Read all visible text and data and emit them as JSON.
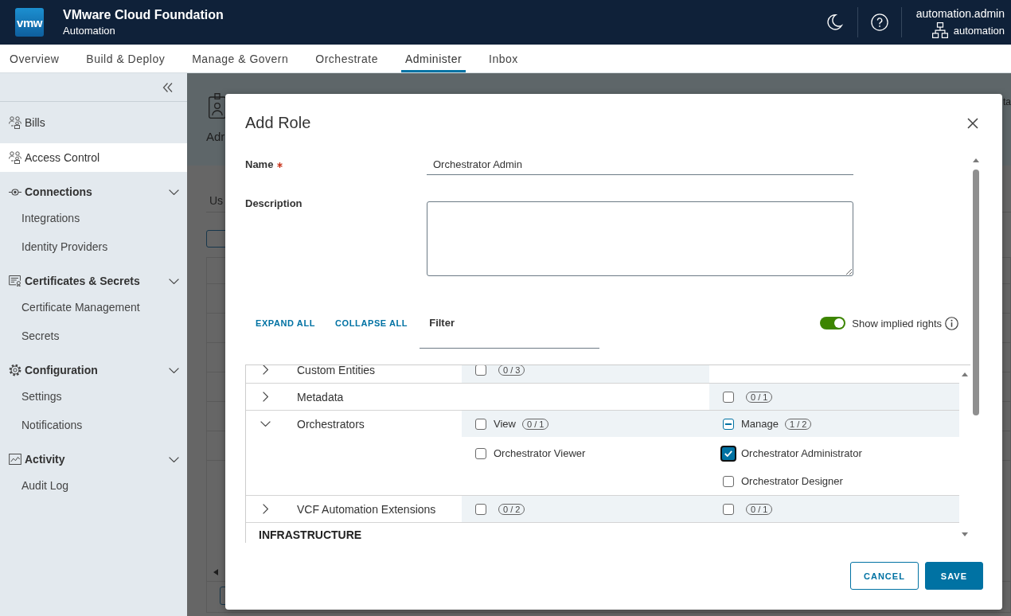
{
  "header": {
    "logo": "vmw",
    "title": "VMware Cloud Foundation",
    "subtitle": "Automation",
    "user": "automation.admin",
    "org": "automation"
  },
  "nav_tabs": [
    {
      "label": "Overview",
      "selected": false
    },
    {
      "label": "Build & Deploy",
      "selected": false
    },
    {
      "label": "Manage & Govern",
      "selected": false
    },
    {
      "label": "Orchestrate",
      "selected": false
    },
    {
      "label": "Administer",
      "selected": true
    },
    {
      "label": "Inbox",
      "selected": false
    }
  ],
  "sidebar": {
    "items": [
      {
        "kind": "link",
        "label": "Bills",
        "selected": false
      },
      {
        "kind": "link",
        "label": "Access Control",
        "selected": true
      },
      {
        "kind": "section",
        "label": "Connections",
        "expanded": true,
        "children": [
          {
            "label": "Integrations",
            "selected": false
          },
          {
            "label": "Identity Providers",
            "selected": false
          }
        ]
      },
      {
        "kind": "section",
        "label": "Certificates & Secrets",
        "expanded": true,
        "children": [
          {
            "label": "Certificate Management",
            "selected": false
          },
          {
            "label": "Secrets",
            "selected": false
          }
        ]
      },
      {
        "kind": "section",
        "label": "Configuration",
        "expanded": true,
        "children": [
          {
            "label": "Settings",
            "selected": false
          },
          {
            "label": "Notifications",
            "selected": false
          }
        ]
      },
      {
        "kind": "section",
        "label": "Activity",
        "expanded": true,
        "children": [
          {
            "label": "Audit Log",
            "selected": false
          }
        ]
      }
    ]
  },
  "background_page": {
    "heading": "Adr",
    "corner_text": "ta",
    "tab": "Us"
  },
  "dialog": {
    "title": "Add Role",
    "fields": [
      {
        "kind": "input",
        "label": "Name",
        "required": true,
        "value": "Orchestrator Admin"
      },
      {
        "kind": "textarea",
        "label": "Description",
        "required": false
      }
    ],
    "actions": [
      {
        "label": "EXPAND ALL"
      },
      {
        "label": "COLLAPSE ALL"
      }
    ],
    "filter": {
      "placeholder": "Filter"
    },
    "implied_rights": {
      "label": "Show implied rights",
      "on": true
    },
    "permissions": [
      {
        "kind": "group",
        "name": "Custom Entities",
        "expanded": false,
        "column_1": {
          "checked": false,
          "indeterminate": false,
          "count": "0 / 3"
        }
      },
      {
        "kind": "group",
        "name": "Metadata",
        "expanded": false,
        "column_2": {
          "checked": false,
          "indeterminate": false,
          "count": "0 / 1"
        }
      },
      {
        "kind": "group",
        "name": "Orchestrators",
        "expanded": true,
        "column_1": {
          "checked": false,
          "indeterminate": false,
          "label": "View",
          "count": "0 / 1",
          "children": [
            {
              "label": "Orchestrator Viewer",
              "checked": false,
              "focused": false
            }
          ]
        },
        "column_2": {
          "checked": false,
          "indeterminate": true,
          "label": "Manage",
          "count": "1 / 2",
          "children": [
            {
              "label": "Orchestrator Administrator",
              "checked": true,
              "focused": true
            },
            {
              "label": "Orchestrator Designer",
              "checked": false,
              "focused": false
            }
          ]
        }
      },
      {
        "kind": "group",
        "name": "VCF Automation Extensions",
        "expanded": false,
        "column_1": {
          "checked": false,
          "indeterminate": false,
          "count": "0 / 2"
        },
        "column_2": {
          "checked": false,
          "indeterminate": false,
          "count": "0 / 1"
        }
      },
      {
        "kind": "section",
        "name": "INFRASTRUCTURE"
      }
    ],
    "buttons": [
      {
        "label": "CANCEL",
        "kind": "secondary"
      },
      {
        "label": "SAVE",
        "kind": "primary"
      }
    ]
  }
}
